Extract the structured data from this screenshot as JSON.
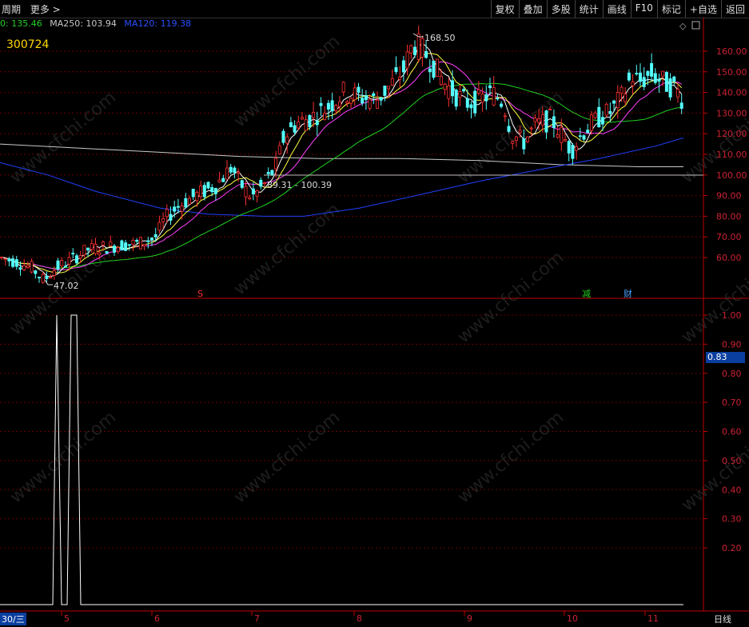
{
  "toolbar": {
    "left": [
      "周期",
      "更多 >"
    ],
    "buttons": [
      "复权",
      "叠加",
      "多股",
      "统计",
      "画线",
      "F10",
      "标记",
      "+自选",
      "返回"
    ]
  },
  "ma_legend": {
    "ma60": "0: 135.46",
    "ma250": "MA250: 103.94",
    "ma120": "MA120: 119.38"
  },
  "stock_code": "300724",
  "price_axis": [
    "160.00",
    "150.00",
    "140.00",
    "130.00",
    "120.00",
    "110.00",
    "100.00",
    "90.00",
    "80.00",
    "70.00",
    "60.00"
  ],
  "indicator_axis": [
    "1.00",
    "0.90",
    "0.80",
    "0.70",
    "0.60",
    "0.50",
    "0.40",
    "0.30",
    "0.20"
  ],
  "indicator_value": "0.83",
  "annotations": {
    "high": "168.50",
    "low": "47.02",
    "range": "89.31 - 100.39"
  },
  "markers": {
    "s": "S",
    "jian": "减",
    "cai": "财"
  },
  "x_axis": {
    "left_label": "30/三",
    "months": [
      "5",
      "6",
      "7",
      "8",
      "9",
      "10",
      "11"
    ],
    "right_label": "日线"
  },
  "watermark": "www.cfchi.com",
  "chart_data": {
    "type": "candlestick",
    "ylim": [
      47,
      170
    ],
    "indicator_ylim": [
      0,
      1.05
    ],
    "highlighted_values": {
      "high": 168.5,
      "low": 47.02,
      "range_low": 89.31,
      "range_high": 100.39,
      "current_indicator": 0.83
    }
  },
  "colors": {
    "up": "#ff3030",
    "down": "#54ffff",
    "ma5": "#ffffff",
    "ma10": "#ffff40",
    "ma20": "#ff40ff",
    "ma60": "#20d020",
    "ma120": "#2040ff",
    "ma250": "#c8c8c8",
    "grid": "#7a0000",
    "axis": "#c00000"
  }
}
